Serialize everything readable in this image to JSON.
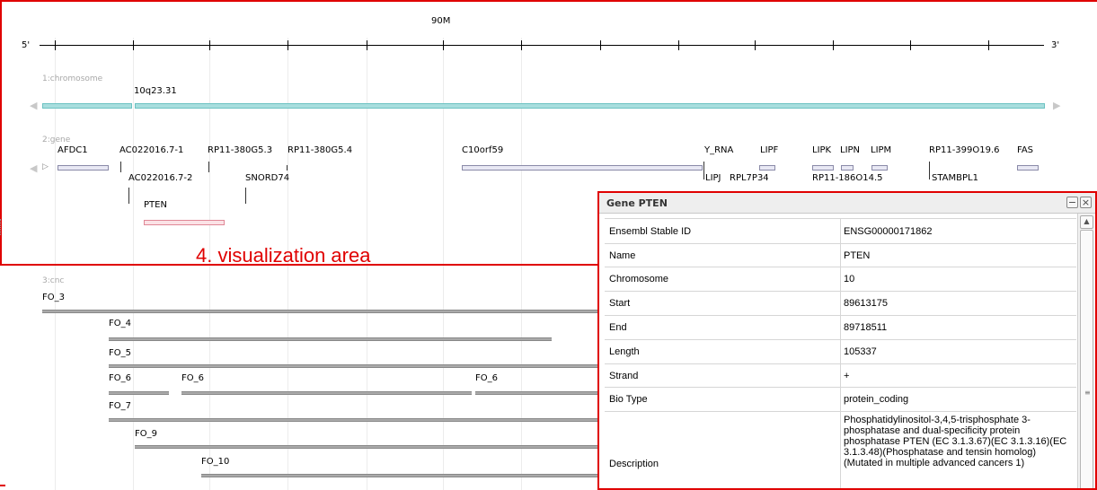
{
  "ruler": {
    "label": "90M",
    "five_prime": "5'",
    "three_prime": "3'"
  },
  "tracks": {
    "chromosome": {
      "title": "1:chromosome",
      "band": "10q23.31"
    },
    "gene": {
      "title": "2:gene",
      "labels": {
        "afdc1": "AFDC1",
        "ac1": "AC022016.7-1",
        "ac2": "AC022016.7-2",
        "rp3": "RP11-380G5.3",
        "rp4": "RP11-380G5.4",
        "snord": "SNORD74",
        "pten": "PTEN",
        "c10": "C10orf59",
        "yrna": "Y_RNA",
        "lipj": "LIPJ",
        "rpl7": "RPL7P34",
        "lipf": "LIPF",
        "lipk": "LIPK",
        "lipn": "LIPN",
        "lipm": "LIPM",
        "rp186": "RP11-186O14.5",
        "rp399": "RP11-399O19.6",
        "fas": "FAS",
        "stambpl1": "STAMBPL1"
      }
    },
    "cnc": {
      "title": "3:cnc",
      "labels": {
        "fo3": "FO_3",
        "fo4": "FO_4",
        "fo5": "FO_5",
        "fo6a": "FO_6",
        "fo6b": "FO_6",
        "fo6c": "FO_6",
        "fo7": "FO_7",
        "fo9": "FO_9",
        "fo10": "FO_10"
      }
    }
  },
  "annotation": {
    "label": "4. visualization area",
    "color": "#e00000"
  },
  "panel": {
    "title": "Gene PTEN",
    "minimize": "−",
    "close": "×",
    "rows": [
      {
        "key": "Ensembl Stable ID",
        "value": "ENSG00000171862"
      },
      {
        "key": "Name",
        "value": "PTEN"
      },
      {
        "key": "Chromosome",
        "value": "10"
      },
      {
        "key": "Start",
        "value": "89613175"
      },
      {
        "key": "End",
        "value": "89718511"
      },
      {
        "key": "Length",
        "value": "105337"
      },
      {
        "key": "Strand",
        "value": "+"
      },
      {
        "key": "Bio Type",
        "value": "protein_coding"
      },
      {
        "key": "Description",
        "value": "Phosphatidylinositol-3,4,5-trisphosphate 3-phosphatase and dual-specificity protein phosphatase PTEN (EC 3.1.3.67)(EC 3.1.3.16)(EC 3.1.3.48)(Phosphatase and tensin homolog)(Mutated in multiple advanced cancers 1)"
      }
    ]
  },
  "colors": {
    "chromosome": "#a8dede",
    "pten": "#f0b0b8",
    "highlight": "#e00000"
  }
}
